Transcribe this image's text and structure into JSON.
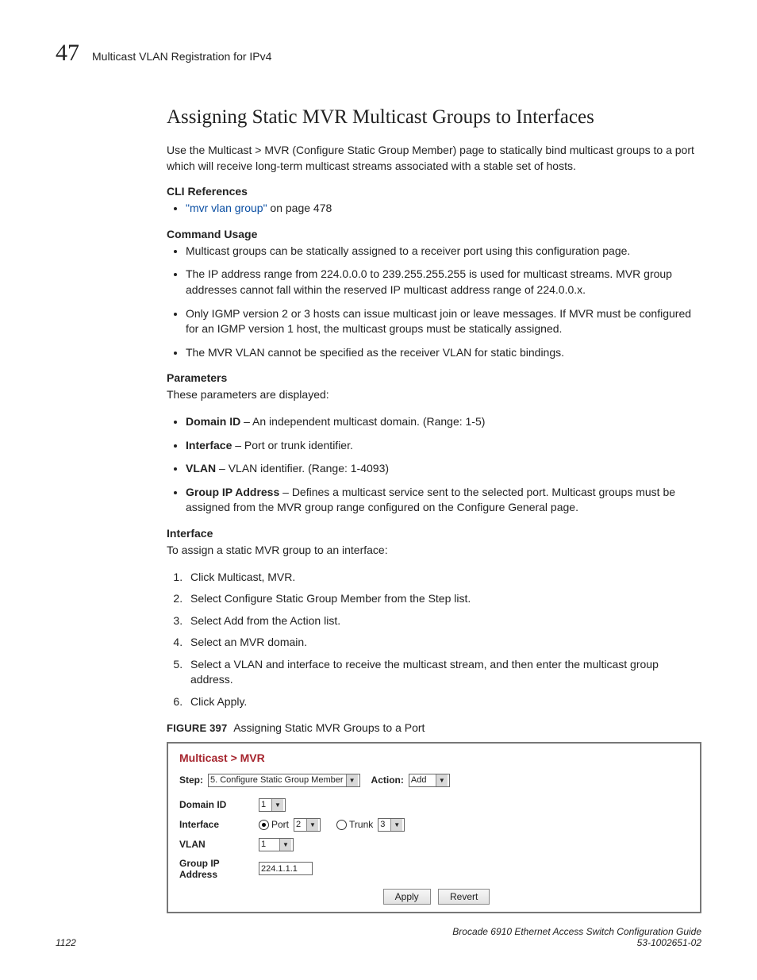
{
  "header": {
    "chapterNumber": "47",
    "chapterTitle": "Multicast VLAN Registration for IPv4"
  },
  "title": "Assigning Static MVR Multicast Groups to Interfaces",
  "intro": "Use the Multicast > MVR (Configure Static Group Member) page to statically bind multicast groups to a port which will receive long-term multicast streams associated with a stable set of hosts.",
  "cliRef": {
    "heading": "CLI References",
    "linkText": "\"mvr vlan group\"",
    "linkSuffix": " on page 478"
  },
  "commandUsage": {
    "heading": "Command Usage",
    "bullets": [
      "Multicast groups can be statically assigned to a receiver port using this configuration page.",
      "The IP address range from 224.0.0.0 to 239.255.255.255 is used for multicast streams. MVR group addresses cannot fall within the reserved IP multicast address range of 224.0.0.x.",
      "Only IGMP version 2 or 3 hosts can issue multicast join or leave messages. If MVR must be configured for an IGMP version 1 host, the multicast groups must be statically assigned.",
      "The MVR VLAN cannot be specified as the receiver VLAN for static bindings."
    ]
  },
  "parameters": {
    "heading": "Parameters",
    "intro": "These parameters are displayed:",
    "items": [
      {
        "name": "Domain ID",
        "desc": " – An independent multicast domain. (Range: 1-5)"
      },
      {
        "name": "Interface",
        "desc": " – Port or trunk identifier."
      },
      {
        "name": "VLAN",
        "desc": " – VLAN identifier. (Range: 1-4093)"
      },
      {
        "name": "Group IP Address",
        "desc": " – Defines a multicast service sent to the selected port. Multicast groups must be assigned from the MVR group range configured on the Configure General page."
      }
    ]
  },
  "interface": {
    "heading": "Interface",
    "intro": "To assign a static MVR group to an interface:",
    "steps": [
      "Click Multicast, MVR.",
      "Select Configure Static Group Member from the Step list.",
      "Select Add from the Action list.",
      "Select an MVR domain.",
      "Select a VLAN and interface to receive the multicast stream, and then enter the multicast group address.",
      "Click Apply."
    ]
  },
  "figure": {
    "label": "FIGURE 397",
    "caption": "Assigning Static MVR Groups to a Port",
    "breadcrumb": "Multicast > MVR",
    "stepLabel": "Step:",
    "stepValue": "5. Configure Static Group Member",
    "actionLabel": "Action:",
    "actionValue": "Add",
    "fields": {
      "domainIdLabel": "Domain ID",
      "domainIdValue": "1",
      "interfaceLabel": "Interface",
      "portLabel": "Port",
      "portValue": "2",
      "trunkLabel": "Trunk",
      "trunkValue": "3",
      "vlanLabel": "VLAN",
      "vlanValue": "1",
      "groupIpLabel": "Group IP Address",
      "groupIpValue": "224.1.1.1"
    },
    "buttons": {
      "apply": "Apply",
      "revert": "Revert"
    }
  },
  "footer": {
    "pageNum": "1122",
    "docTitle": "Brocade 6910 Ethernet Access Switch Configuration Guide",
    "docNum": "53-1002651-02"
  }
}
